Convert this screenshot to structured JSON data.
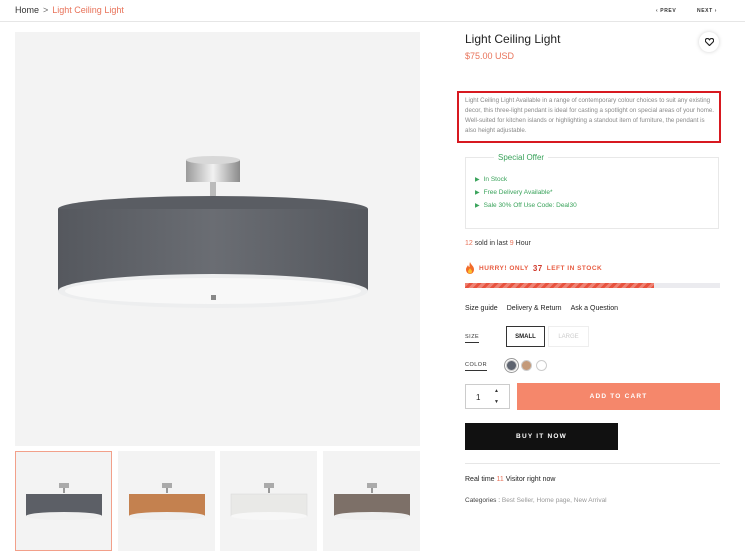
{
  "breadcrumb": {
    "home": "Home",
    "separator": ">",
    "current": "Light Ceiling Light"
  },
  "pager": {
    "prev": "PREV",
    "next": "NEXT"
  },
  "product": {
    "title": "Light Ceiling Light",
    "price": "$75.00 USD",
    "description": "Light Ceiling Light Available in a range of contemporary colour choices to suit any existing decor, this three-light pendant is ideal for casting a spotlight on special areas of your home. Well-suited for kitchen islands or highlighting a standout item of furniture, the pendant is also height adjustable."
  },
  "offer": {
    "title": "Special Offer",
    "items": [
      "In Stock",
      "Free Delivery Available*",
      "Sale 30% Off Use Code: Deal30"
    ]
  },
  "sold": {
    "count": "12",
    "mid": "sold in last",
    "hours": "9",
    "unit": "Hour"
  },
  "hurry": {
    "pre": "HURRY! ONLY",
    "count": "37",
    "post": "LEFT IN STOCK",
    "progress": 0.74
  },
  "links": [
    "Size guide",
    "Delivery & Return",
    "Ask a Question"
  ],
  "size": {
    "label": "SIZE",
    "options": [
      "SMALL",
      "LARGE"
    ],
    "selected": "SMALL"
  },
  "color": {
    "label": "COLOR",
    "swatches": [
      "#5e6470",
      "#c49a7a",
      "#ffffff"
    ],
    "selected_index": 0
  },
  "quantity": {
    "value": "1"
  },
  "buttons": {
    "add_to_cart": "ADD TO CART",
    "buy_now": "BUY IT NOW"
  },
  "realtime": {
    "pre": "Real time",
    "count": "11",
    "post": "Visitor right now"
  },
  "categories": {
    "label": "Categories :",
    "values": "Best Seller, Home page, New Arrival"
  },
  "colors": {
    "accent": "#e8735a",
    "offer_green": "#3aa35b",
    "cart": "#f5876b",
    "highlight": "#d71920"
  },
  "images": {
    "thumbnails": [
      {
        "shade": "#5c5f66",
        "name": "grey-shade"
      },
      {
        "shade": "#c4814f",
        "name": "copper-shade"
      },
      {
        "shade": "#e9e9e7",
        "name": "white-shade"
      },
      {
        "shade": "#7d7068",
        "name": "taupe-shade"
      }
    ]
  }
}
